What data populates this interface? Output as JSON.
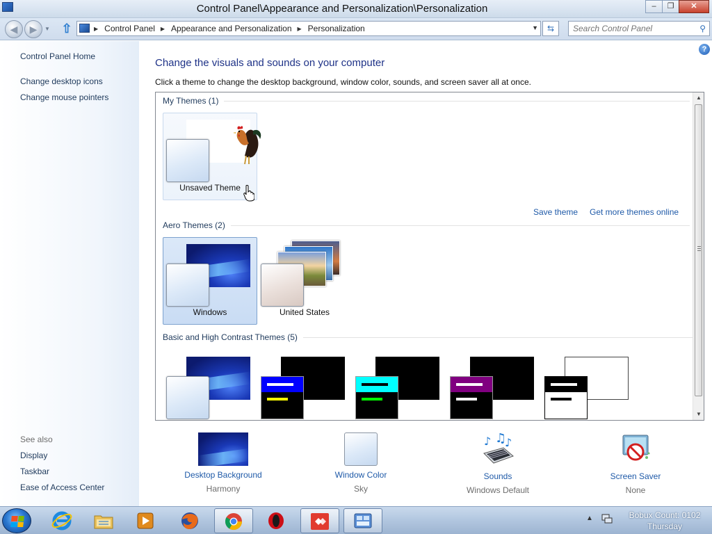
{
  "window": {
    "title": "Control Panel\\Appearance and Personalization\\Personalization",
    "minimize": "–",
    "restore": "❐",
    "close": "✕"
  },
  "address": {
    "crumbs": [
      "Control Panel",
      "Appearance and Personalization",
      "Personalization"
    ],
    "search_placeholder": "Search Control Panel"
  },
  "sidebar": {
    "home": "Control Panel Home",
    "links": [
      "Change desktop icons",
      "Change mouse pointers"
    ],
    "see_also_title": "See also",
    "see_also": [
      "Display",
      "Taskbar",
      "Ease of Access Center"
    ]
  },
  "main": {
    "heading": "Change the visuals and sounds on your computer",
    "subtext": "Click a theme to change the desktop background, window color, sounds, and screen saver all at once.",
    "help": "?"
  },
  "themes": {
    "my_themes_title": "My Themes (1)",
    "my_themes": [
      {
        "label": "Unsaved Theme"
      }
    ],
    "save_theme": "Save theme",
    "get_more": "Get more themes online",
    "aero_title": "Aero Themes (2)",
    "aero": [
      {
        "label": "Windows",
        "selected": true
      },
      {
        "label": "United States",
        "selected": false
      }
    ],
    "basic_title": "Basic and High Contrast Themes (5)",
    "basic": [
      {
        "name": "harmony"
      },
      {
        "name": "high-contrast-1",
        "bar": "#0000ff",
        "line1": "#ffffff",
        "line2": "#ffff00"
      },
      {
        "name": "high-contrast-2",
        "bar": "#00ffff",
        "line1": "#000000",
        "line2": "#00ff00"
      },
      {
        "name": "high-contrast-black",
        "bar": "#800080",
        "line1": "#ffffff",
        "line2": "#ffffff"
      },
      {
        "name": "high-contrast-white",
        "bar": "#000000",
        "line1": "#ffffff",
        "line2": "#000000"
      }
    ]
  },
  "settings": [
    {
      "name": "Desktop Background",
      "value": "Harmony"
    },
    {
      "name": "Window Color",
      "value": "Sky"
    },
    {
      "name": "Sounds",
      "value": "Windows Default"
    },
    {
      "name": "Screen Saver",
      "value": "None"
    }
  ],
  "taskbar": {
    "apps": [
      "internet-explorer",
      "file-explorer",
      "media-player",
      "firefox",
      "chrome",
      "opera",
      "anydesk",
      "control-panel"
    ],
    "active_app": "control-panel",
    "clock_line1": "Bobux Count: 0102",
    "clock_line2": "Thursday"
  },
  "colors": {
    "link": "#1f5aa8",
    "heading": "#1e3287",
    "selection": "#c9dcf4"
  }
}
